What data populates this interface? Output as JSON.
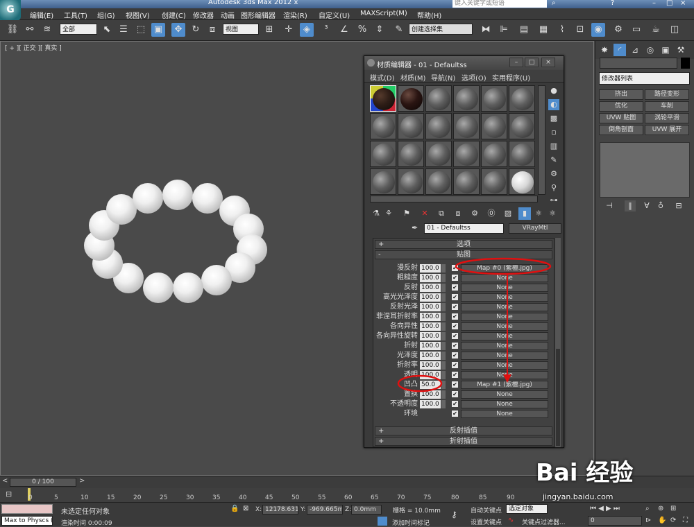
{
  "app": {
    "title": "Autodesk 3ds Max  2012 x",
    "search_placeholder": "键入关键字或短语",
    "logo_letter": "G"
  },
  "menu": [
    "编辑(E)",
    "工具(T)",
    "组(G)",
    "视图(V)",
    "创建(C)",
    "修改器",
    "动画",
    "图形编辑器",
    "渲染(R)",
    "自定义(U)",
    "MAXScript(M)",
    "帮助(H)"
  ],
  "toolbar": {
    "selection_filter": "全部",
    "ref_coord": "视图",
    "named_selection": "创建选择集"
  },
  "viewport": {
    "label": "[ + ][ 正交 ][ 真实 ]"
  },
  "command_panel": {
    "modifier_list": "修改器列表",
    "buttons": [
      "挤出",
      "路径变形",
      "优化",
      "车削",
      "UVW 贴图",
      "涡轮平滑",
      "倒角剖面",
      "UVW 展开"
    ]
  },
  "material_editor": {
    "title": "材质编辑器 - 01 - Defaultss",
    "menu": [
      "模式(D)",
      "材质(M)",
      "导航(N)",
      "选项(O)",
      "实用程序(U)"
    ],
    "material_name": "01 - Defaultss",
    "material_type": "VRayMtl",
    "rollout_options": "选项",
    "rollout_maps": "贴图",
    "rollout_reflect_interp": "反射插值",
    "rollout_refract_interp": "折射插值",
    "maps": [
      {
        "label": "漫反射",
        "value": "100.0",
        "map": "Map #0 (紫檀.jpg)"
      },
      {
        "label": "粗糙度",
        "value": "100.0",
        "map": "None"
      },
      {
        "label": "反射",
        "value": "100.0",
        "map": "None"
      },
      {
        "label": "高光光泽度",
        "value": "100.0",
        "map": "None"
      },
      {
        "label": "反射光泽",
        "value": "100.0",
        "map": "None"
      },
      {
        "label": "菲涅耳折射率",
        "value": "100.0",
        "map": "None"
      },
      {
        "label": "各向异性",
        "value": "100.0",
        "map": "None"
      },
      {
        "label": "各向异性旋转",
        "value": "100.0",
        "map": "None"
      },
      {
        "label": "折射",
        "value": "100.0",
        "map": "None"
      },
      {
        "label": "光泽度",
        "value": "100.0",
        "map": "None"
      },
      {
        "label": "折射率",
        "value": "100.0",
        "map": "None"
      },
      {
        "label": "透明",
        "value": "100.0",
        "map": "None"
      },
      {
        "label": "凹凸",
        "value": "50.0",
        "map": "Map #1 (紫檀.jpg)"
      },
      {
        "label": "置换",
        "value": "100.0",
        "map": "None"
      },
      {
        "label": "不透明度",
        "value": "100.0",
        "map": "None"
      },
      {
        "label": "环境",
        "value": "",
        "map": "None"
      }
    ]
  },
  "timeline": {
    "frame_display": "0 / 100",
    "ticks": [
      "0",
      "5",
      "10",
      "15",
      "20",
      "25",
      "30",
      "35",
      "40",
      "45",
      "50",
      "55",
      "60",
      "65",
      "70",
      "75",
      "80",
      "85",
      "90"
    ]
  },
  "status": {
    "selection_text": "未选定任何对象",
    "render_time": "渲染时间 0:00:09",
    "script_listener": "Max to Physcs (",
    "x_label": "X:",
    "x_value": "12178.631",
    "y_label": "Y:",
    "y_value": "-969.665m",
    "z_label": "Z:",
    "z_value": "0.0mm",
    "grid": "栅格 = 10.0mm",
    "add_time_tag": "添加时间标记",
    "auto_key": "自动关键点",
    "selected_object": "选定对象",
    "set_key": "设置关键点",
    "key_filters": "关键点过滤器...",
    "frame_value": "0"
  },
  "watermark": {
    "main": "Bai 经验",
    "sub": "jingyan.baidu.com"
  },
  "colors": {
    "accent_blue": "#4f8ccc",
    "annotation_red": "#e01010"
  }
}
